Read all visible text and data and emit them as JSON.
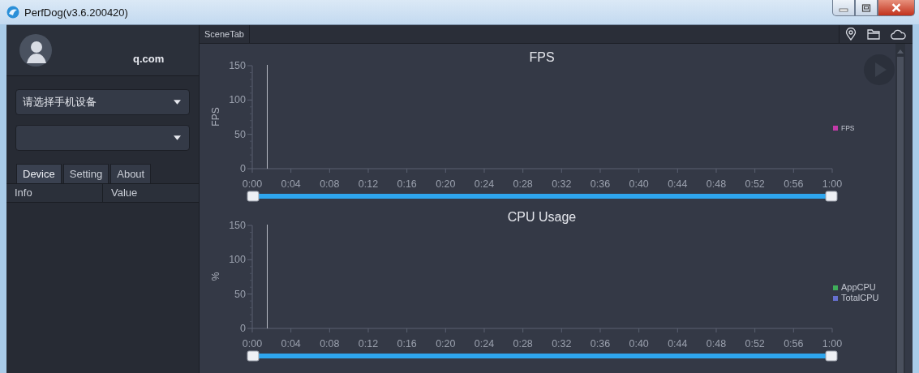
{
  "window": {
    "title": "PerfDog(v3.6.200420)"
  },
  "account": {
    "email": "q.com"
  },
  "device_select": {
    "placeholder": "请选择手机设备"
  },
  "left_tabs": [
    {
      "label": "Device",
      "selected": true
    },
    {
      "label": "Setting",
      "selected": false
    },
    {
      "label": "About",
      "selected": false
    }
  ],
  "info_table": {
    "columns": [
      "Info",
      "Value"
    ]
  },
  "scene_tabs": [
    {
      "label": "SceneTab"
    }
  ],
  "charts": [
    {
      "chart_data": {
        "type": "line",
        "title": "FPS",
        "ylabel": "FPS",
        "ylim": [
          0,
          150
        ],
        "yticks": [
          0,
          50,
          100,
          150
        ],
        "categories": [
          "0:00",
          "0:04",
          "0:08",
          "0:12",
          "0:16",
          "0:20",
          "0:24",
          "0:28",
          "0:32",
          "0:36",
          "0:40",
          "0:44",
          "0:48",
          "0:52",
          "0:56",
          "1:00"
        ],
        "series": [
          {
            "name": "FPS",
            "color": "#c23aa8",
            "values": [
              null,
              null,
              null,
              null,
              null,
              null,
              null,
              null,
              null,
              null,
              null,
              null,
              null,
              null,
              null,
              null
            ]
          }
        ]
      }
    },
    {
      "chart_data": {
        "type": "line",
        "title": "CPU Usage",
        "ylabel": "%",
        "ylim": [
          0,
          150
        ],
        "yticks": [
          0,
          50,
          100,
          150
        ],
        "categories": [
          "0:00",
          "0:04",
          "0:08",
          "0:12",
          "0:16",
          "0:20",
          "0:24",
          "0:28",
          "0:32",
          "0:36",
          "0:40",
          "0:44",
          "0:48",
          "0:52",
          "0:56",
          "1:00"
        ],
        "series": [
          {
            "name": "AppCPU",
            "color": "#3fae5a",
            "values": [
              null,
              null,
              null,
              null,
              null,
              null,
              null,
              null,
              null,
              null,
              null,
              null,
              null,
              null,
              null,
              null
            ]
          },
          {
            "name": "TotalCPU",
            "color": "#6670d0",
            "values": [
              null,
              null,
              null,
              null,
              null,
              null,
              null,
              null,
              null,
              null,
              null,
              null,
              null,
              null,
              null,
              null
            ]
          }
        ]
      }
    }
  ]
}
